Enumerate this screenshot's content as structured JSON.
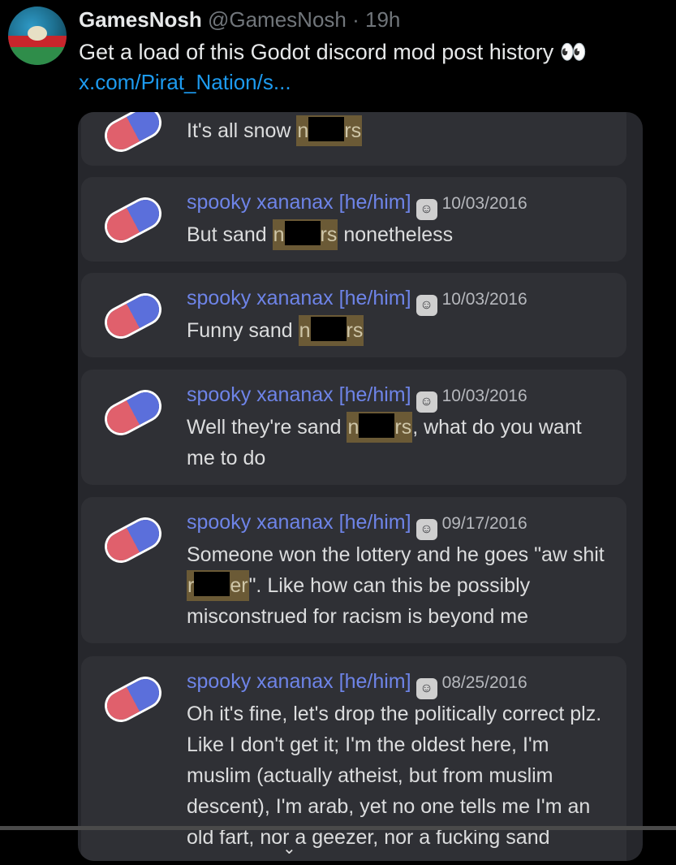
{
  "tweet": {
    "author_name": "GamesNosh",
    "author_handle": "@GamesNosh",
    "time": "· 19h",
    "text": "Get a load of this Godot discord mod post history",
    "emoji": "👀",
    "link": "x.com/Pirat_Nation/s..."
  },
  "discord": {
    "username": "spooky xananax [he/him]",
    "messages": [
      {
        "date": "",
        "parts": [
          "It's all snow ",
          "n",
          "rs",
          ""
        ]
      },
      {
        "date": "10/03/2016",
        "parts": [
          "But sand ",
          "n",
          "rs",
          " nonetheless"
        ]
      },
      {
        "date": "10/03/2016",
        "parts": [
          "Funny sand ",
          "n",
          "rs",
          ""
        ]
      },
      {
        "date": "10/03/2016",
        "parts": [
          "Well they're sand ",
          "n",
          "rs",
          ", what do you want me to do"
        ]
      },
      {
        "date": "09/17/2016",
        "parts": [
          "Someone won the lottery and he goes \"aw shit ",
          "r",
          "er",
          "\". Like how can this be possibly misconstrued for racism is beyond me"
        ]
      },
      {
        "date": "08/25/2016",
        "parts": [
          "Oh it's fine, let's drop the politically correct plz. Like I don't get it; I'm the oldest here, I'm muslim (actually atheist, but from muslim descent), I'm arab, yet no one tells me I'm an old fart, nor a geezer, nor a fucking sand",
          "",
          "",
          ""
        ]
      }
    ]
  },
  "ui": {
    "chevron": "⌄"
  }
}
